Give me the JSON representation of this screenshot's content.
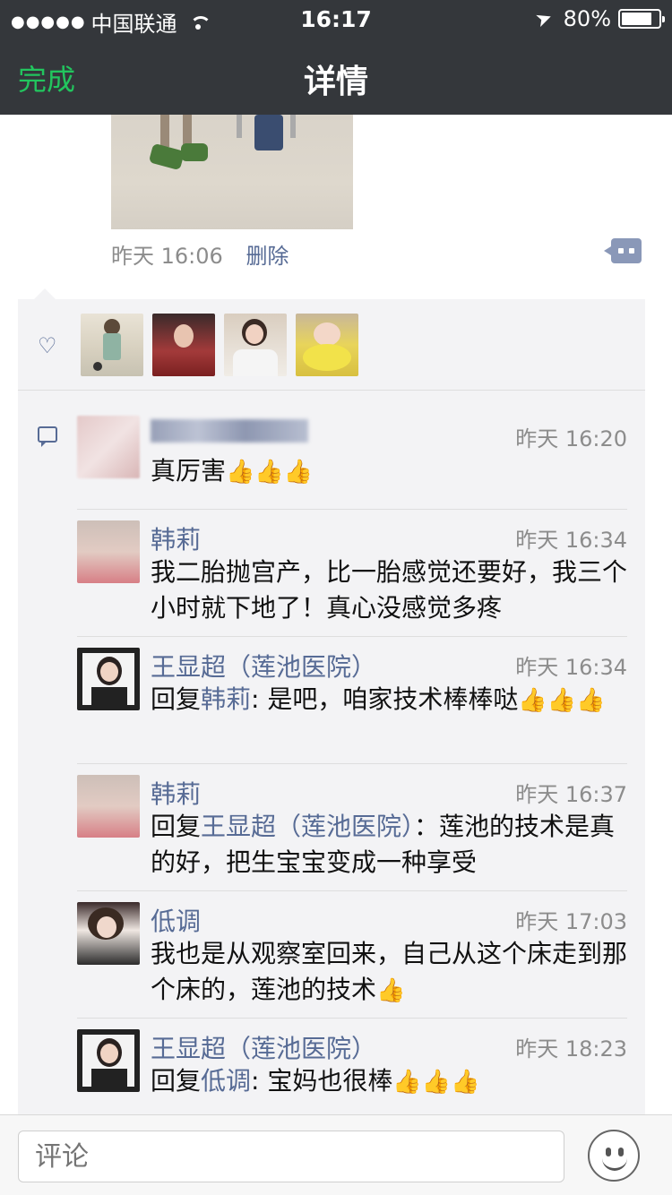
{
  "status_bar": {
    "signal": "●●●●●",
    "carrier": "中国联通",
    "time": "16:17",
    "battery": "80%"
  },
  "nav": {
    "done_label": "完成",
    "title": "详情"
  },
  "post": {
    "time": "昨天 16:06",
    "delete_label": "删除"
  },
  "likes": {
    "count_avatars": 4
  },
  "comments": [
    {
      "name": "",
      "time": "昨天 16:20",
      "text": "真厉害",
      "thumbs": "👍👍👍"
    },
    {
      "name": "韩莉",
      "time": "昨天 16:34",
      "text": "我二胎抛宫产，比一胎感觉还要好，我三个小时就下地了！真心没感觉多疼"
    },
    {
      "name": "王显超（莲池医院）",
      "time": "昨天 16:34",
      "reply_prefix": "回复",
      "reply_to": "韩莉",
      "text": ": 是吧，咱家技术棒棒哒",
      "thumbs": "👍👍👍"
    },
    {
      "name": "韩莉",
      "time": "昨天 16:37",
      "reply_prefix": "回复",
      "reply_to": "王显超（莲池医院）",
      "text": "：莲池的技术是真的好，把生宝宝变成一种享受"
    },
    {
      "name": "低调",
      "time": "昨天 17:03",
      "text": "我也是从观察室回来，自己从这个床走到那个床的，莲池的技术",
      "thumbs": "👍"
    },
    {
      "name": "王显超（莲池医院）",
      "time": "昨天 18:23",
      "reply_prefix": "回复",
      "reply_to": "低调",
      "text": ": 宝妈也很棒",
      "thumbs": "👍👍👍"
    }
  ],
  "composer": {
    "placeholder": "评论"
  },
  "colors": {
    "header_bg": "#34373b",
    "done_green": "#22c55e",
    "link_blue": "#576b95",
    "panel_bg": "#f3f3f5"
  }
}
